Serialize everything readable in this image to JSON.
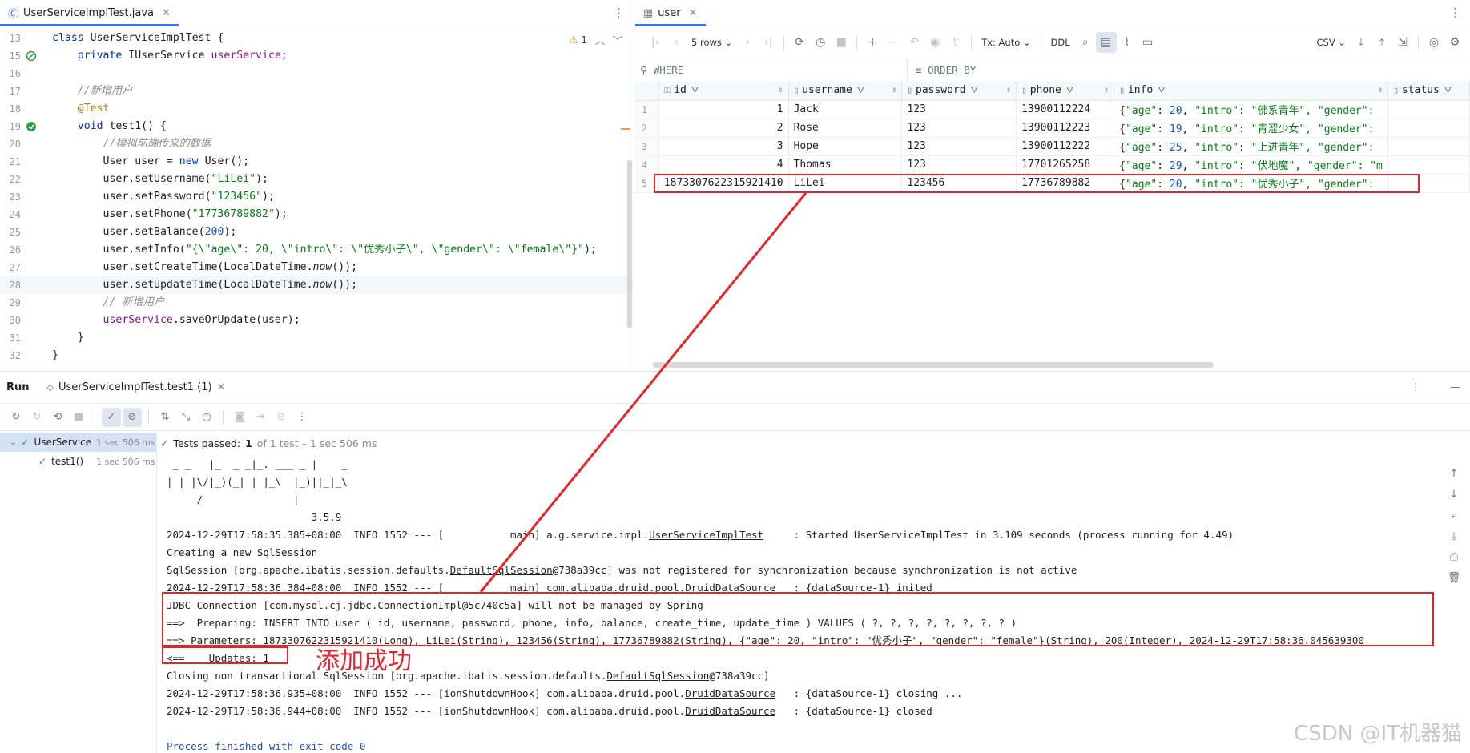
{
  "editor": {
    "tab_label": "UserServiceImplTest.java",
    "warning_count": "1",
    "lines": [
      {
        "n": "13",
        "html": "<span class=\"kw\">class</span> UserServiceImplTest {"
      },
      {
        "n": "15",
        "html": "    <span class=\"kw\">private</span> IUserService <span class=\"fld\">userService</span>;"
      },
      {
        "n": "16",
        "html": ""
      },
      {
        "n": "17",
        "html": "    <span class=\"cmt\">//新增用户</span>"
      },
      {
        "n": "18",
        "html": "    <span class=\"ann\">@Test</span>"
      },
      {
        "n": "19",
        "html": "    <span class=\"kw\">void</span> test1() {"
      },
      {
        "n": "20",
        "html": "        <span class=\"cmt\">//模拟前端传来的数据</span>"
      },
      {
        "n": "21",
        "html": "        User user = <span class=\"kw\">new</span> User();"
      },
      {
        "n": "22",
        "html": "        user.setUsername(<span class=\"str\">\"LiLei\"</span>);"
      },
      {
        "n": "23",
        "html": "        user.setPassword(<span class=\"str\">\"123456\"</span>);"
      },
      {
        "n": "24",
        "html": "        user.setPhone(<span class=\"str\">\"17736789882\"</span>);"
      },
      {
        "n": "25",
        "html": "        user.setBalance(<span class=\"num\">200</span>);"
      },
      {
        "n": "26",
        "html": "        user.setInfo(<span class=\"str\">\"{\\\"age\\\": 20, \\\"intro\\\": \\\"优秀小子\\\", \\\"gender\\\": \\\"female\\\"}\"</span>);"
      },
      {
        "n": "27",
        "html": "        user.setCreateTime(LocalDateTime.<span class=\"it\">now</span>());"
      },
      {
        "n": "28",
        "html": "        user.setUpdateTime(LocalDateTime.<span class=\"it\">now</span>());"
      },
      {
        "n": "29",
        "html": "        <span class=\"cmt\">// 新增用户</span>"
      },
      {
        "n": "30",
        "html": "        <span class=\"fld\">userService</span>.saveOrUpdate(user);"
      },
      {
        "n": "31",
        "html": "    }"
      },
      {
        "n": "32",
        "html": "}"
      }
    ]
  },
  "db": {
    "tab_label": "user",
    "rows_label": "5 rows",
    "tx_label": "Tx: Auto",
    "ddl_label": "DDL",
    "export_label": "CSV",
    "where_label": "WHERE",
    "orderby_label": "ORDER BY",
    "columns": [
      "id",
      "username",
      "password",
      "phone",
      "info",
      "status"
    ],
    "rows": [
      {
        "rn": "1",
        "id": "1",
        "username": "Jack",
        "password": "123",
        "phone": "13900112224",
        "age": "20",
        "intro": "佛系青年",
        "tail": ", \"gender\":"
      },
      {
        "rn": "2",
        "id": "2",
        "username": "Rose",
        "password": "123",
        "phone": "13900112223",
        "age": "19",
        "intro": "青涩少女",
        "tail": ", \"gender\":"
      },
      {
        "rn": "3",
        "id": "3",
        "username": "Hope",
        "password": "123",
        "phone": "13900112222",
        "age": "25",
        "intro": "上进青年",
        "tail": ", \"gender\":"
      },
      {
        "rn": "4",
        "id": "4",
        "username": "Thomas",
        "password": "123",
        "phone": "17701265258",
        "age": "29",
        "intro": "伏地魔",
        "tail": ", \"gender\": \"m"
      },
      {
        "rn": "5",
        "id": "1873307622315921410",
        "username": "LiLei",
        "password": "123456",
        "phone": "17736789882",
        "age": "20",
        "intro": "优秀小子",
        "tail": ", \"gender\":"
      }
    ]
  },
  "run": {
    "title": "Run",
    "config_tab": "UserServiceImplTest.test1 (1)",
    "tree_root": "UserService",
    "tree_root_time": "1 sec 506 ms",
    "tree_child": "test1()",
    "tree_child_time": "1 sec 506 ms",
    "status_bold": "Tests passed:",
    "status_count": "1",
    "status_rest": "of 1 test – 1 sec 506 ms",
    "console": [
      " _ _   |_  _ _|_. ___ _ |    _",
      "| | |\\/|_)(_| | |_\\  |_)||_|_\\",
      "     /               |",
      "                        3.5.9",
      "2024-12-29T17:58:35.385+08:00  INFO 1552 --- [           main] a.g.service.impl.UserServiceImplTest     : Started UserServiceImplTest in 3.109 seconds (process running for 4.49)",
      "Creating a new SqlSession",
      "SqlSession [org.apache.ibatis.session.defaults.DefaultSqlSession@738a39cc] was not registered for synchronization because synchronization is not active",
      "2024-12-29T17:58:36.384+08:00  INFO 1552 --- [           main] com.alibaba.druid.pool.DruidDataSource   : {dataSource-1} inited",
      "JDBC Connection [com.mysql.cj.jdbc.ConnectionImpl@5c740c5a] will not be managed by Spring",
      "==>  Preparing: INSERT INTO user ( id, username, password, phone, info, balance, create_time, update_time ) VALUES ( ?, ?, ?, ?, ?, ?, ?, ? )",
      "==> Parameters: 1873307622315921410(Long), LiLei(String), 123456(String), 17736789882(String), {\"age\": 20, \"intro\": \"优秀小子\", \"gender\": \"female\"}(String), 200(Integer), 2024-12-29T17:58:36.045639300",
      "<==    Updates: 1",
      "Closing non transactional SqlSession [org.apache.ibatis.session.defaults.DefaultSqlSession@738a39cc]",
      "2024-12-29T17:58:36.935+08:00  INFO 1552 --- [ionShutdownHook] com.alibaba.druid.pool.DruidDataSource   : {dataSource-1} closing ...",
      "2024-12-29T17:58:36.944+08:00  INFO 1552 --- [ionShutdownHook] com.alibaba.druid.pool.DruidDataSource   : {dataSource-1} closed",
      "",
      "Process finished with exit code 0"
    ]
  },
  "annotation": {
    "success_text": "添加成功",
    "color": "#e3262c"
  },
  "watermark": "CSDN @IT机器猫"
}
